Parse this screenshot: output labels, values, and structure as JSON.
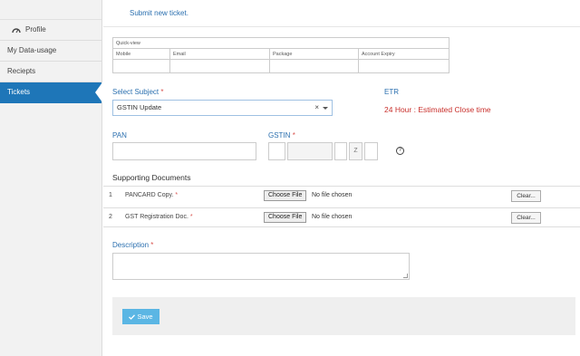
{
  "sidebar": {
    "items": [
      {
        "label": "Profile",
        "icon": "dashboard-icon"
      },
      {
        "label": "My Data-usage"
      },
      {
        "label": "Reciepts"
      },
      {
        "label": "Tickets",
        "active": true
      }
    ]
  },
  "banner": "Submit new ticket.",
  "quick_view": {
    "title": "Quick-view",
    "columns": [
      "Mobile",
      "Email",
      "Package",
      "Account Expiry"
    ],
    "values": [
      "",
      "",
      "",
      ""
    ]
  },
  "form": {
    "subject_label": "Select Subject",
    "subject_value": "GSTIN Update",
    "clear_glyph": "×",
    "etr_label": "ETR",
    "etr_value": "24 Hour : Estimated Close time",
    "pan_label": "PAN",
    "gstin_label": "GSTIN",
    "gstin_fixed_char": "Z",
    "help_glyph": "?",
    "required_mark": "*",
    "docs_title": "Supporting Documents",
    "documents": [
      {
        "num": "1",
        "name": "PANCARD Copy.",
        "choose": "Choose File",
        "status": "No file chosen",
        "clear": "Clear..."
      },
      {
        "num": "2",
        "name": "GST Registration Doc.",
        "choose": "Choose File",
        "status": "No file chosen",
        "clear": "Clear..."
      }
    ],
    "description_label": "Description",
    "save_label": "Save",
    "save_icon": "check-icon"
  },
  "colors": {
    "accent": "#1e76b8",
    "label_blue": "#2a6faf",
    "required_red": "#d9534f",
    "etr_red": "#c9302c",
    "save_button": "#5bb6e4"
  }
}
